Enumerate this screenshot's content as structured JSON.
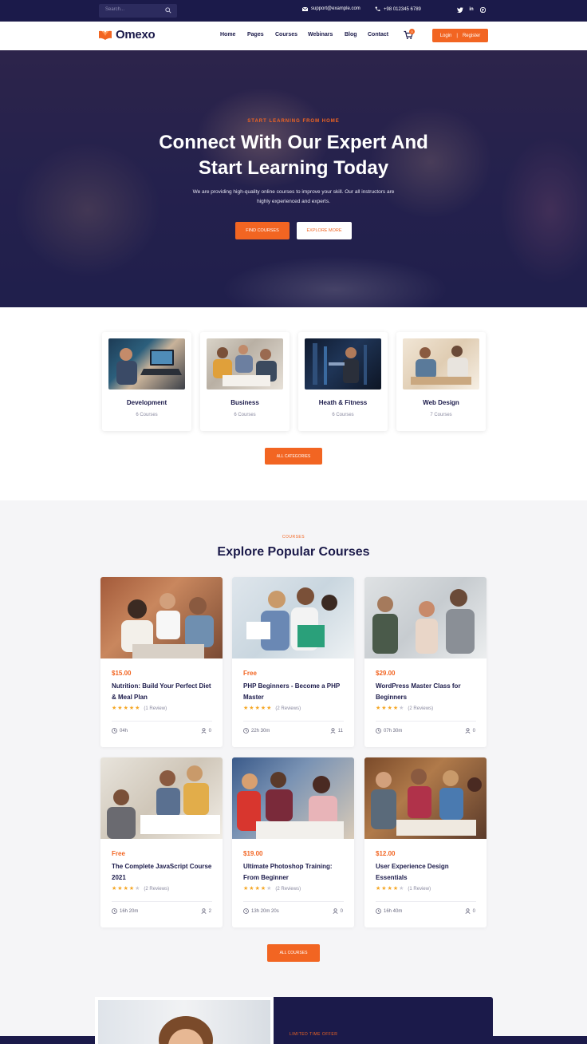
{
  "colors": {
    "primary": "#f26522",
    "dark": "#1b1a4a",
    "star": "#f5a623"
  },
  "topbar": {
    "search_placeholder": "Search...",
    "email": "support@example.com",
    "phone": "+98 012345 6789",
    "social_icons": [
      "twitter-icon",
      "linkedin-icon",
      "pinterest-icon"
    ]
  },
  "nav": {
    "logo_text": "Omexo",
    "items": [
      "Home",
      "Pages",
      "Courses",
      "Webinars",
      "Blog",
      "Contact"
    ],
    "cart_count": "0",
    "login_label": "Login",
    "separator": "|",
    "register_label": "Register"
  },
  "hero": {
    "eyebrow": "START LEARNING FROM HOME",
    "title_line1": "Connect With Our Expert And",
    "title_line2": "Start Learning Today",
    "description": "We are providing high-quality online courses to improve your skill. Our all instructors are highly experienced and experts.",
    "btn_primary": "FIND COURSES",
    "btn_secondary": "EXPLORE MORE"
  },
  "categories": {
    "items": [
      {
        "name": "Development",
        "count": "6 Courses"
      },
      {
        "name": "Business",
        "count": "6 Courses"
      },
      {
        "name": "Heath & Fitness",
        "count": "6 Courses"
      },
      {
        "name": "Web Design",
        "count": "7 Courses"
      }
    ],
    "button": "ALL CATEGORIES"
  },
  "courses": {
    "eyebrow": "COURSES",
    "title": "Explore Popular Courses",
    "items": [
      {
        "price": "$15.00",
        "title": "Nutrition: Build Your Perfect Diet & Meal Plan",
        "rating": 5,
        "reviews": "(1 Review)",
        "duration": "04h",
        "students": "0"
      },
      {
        "price": "Free",
        "title": "PHP Beginners - Become a PHP Master",
        "rating": 5,
        "reviews": "(2 Reviews)",
        "duration": "22h 30m",
        "students": "11"
      },
      {
        "price": "$29.00",
        "title": "WordPress Master Class for Beginners",
        "rating": 4,
        "reviews": "(2 Reviews)",
        "duration": "07h 30m",
        "students": "0"
      },
      {
        "price": "Free",
        "title": "The Complete JavaScript Course 2021",
        "rating": 4,
        "reviews": "(2 Reviews)",
        "duration": "16h 20m",
        "students": "2"
      },
      {
        "price": "$19.00",
        "title": "Ultimate Photoshop Training: From Beginner",
        "rating": 4,
        "reviews": "(2 Reviews)",
        "duration": "13h 20m 20s",
        "students": "0"
      },
      {
        "price": "$12.00",
        "title": "User Experience Design Essentials",
        "rating": 4,
        "reviews": "(1 Review)",
        "duration": "16h 40m",
        "students": "0"
      }
    ],
    "button": "ALL COURSES"
  },
  "offer": {
    "eyebrow": "LIMITED TIME OFFER"
  }
}
